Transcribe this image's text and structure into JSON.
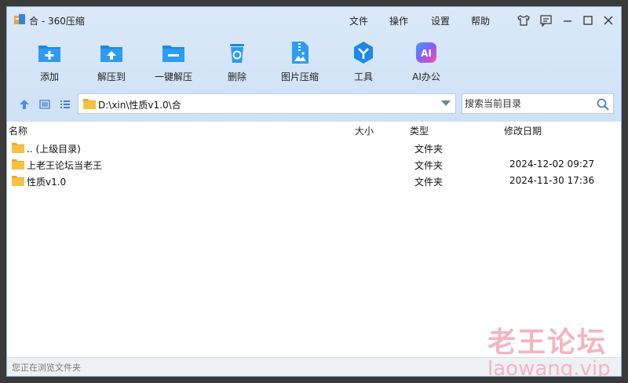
{
  "window": {
    "title": "合 - 360压缩"
  },
  "menu": [
    "文件",
    "操作",
    "设置",
    "帮助"
  ],
  "window_controls": [
    "shirt-icon",
    "feedback-icon",
    "minimize-icon",
    "maximize-icon",
    "close-icon"
  ],
  "toolbar": [
    {
      "label": "添加",
      "icon": "add-folder-icon"
    },
    {
      "label": "解压到",
      "icon": "extract-folder-icon"
    },
    {
      "label": "一键解压",
      "icon": "quick-extract-icon"
    },
    {
      "label": "删除",
      "icon": "recycle-bin-icon"
    },
    {
      "label": "图片压缩",
      "icon": "image-compress-icon"
    },
    {
      "label": "工具",
      "icon": "tools-icon"
    },
    {
      "label": "AI办公",
      "icon": "ai-office-icon"
    }
  ],
  "address": {
    "path": "D:\\xin\\性质v1.0\\合"
  },
  "search": {
    "placeholder": "搜索当前目录"
  },
  "columns": {
    "name": "名称",
    "size": "大小",
    "type": "类型",
    "date": "修改日期"
  },
  "files": [
    {
      "name": ".. (上级目录)",
      "type": "文件夹",
      "date": ""
    },
    {
      "name": "上老王论坛当老王",
      "type": "文件夹",
      "date": "2024-12-02 09:27"
    },
    {
      "name": "性质v1.0",
      "type": "文件夹",
      "date": "2024-11-30 17:36"
    }
  ],
  "status": {
    "text": "您正在浏览文件夹"
  },
  "watermark": {
    "line1": "老王论坛",
    "line2": "laowang.vip"
  },
  "colors": {
    "accent": "#1e88e5",
    "folder": "#f5c242",
    "header_bg": "#d6e6f8"
  }
}
